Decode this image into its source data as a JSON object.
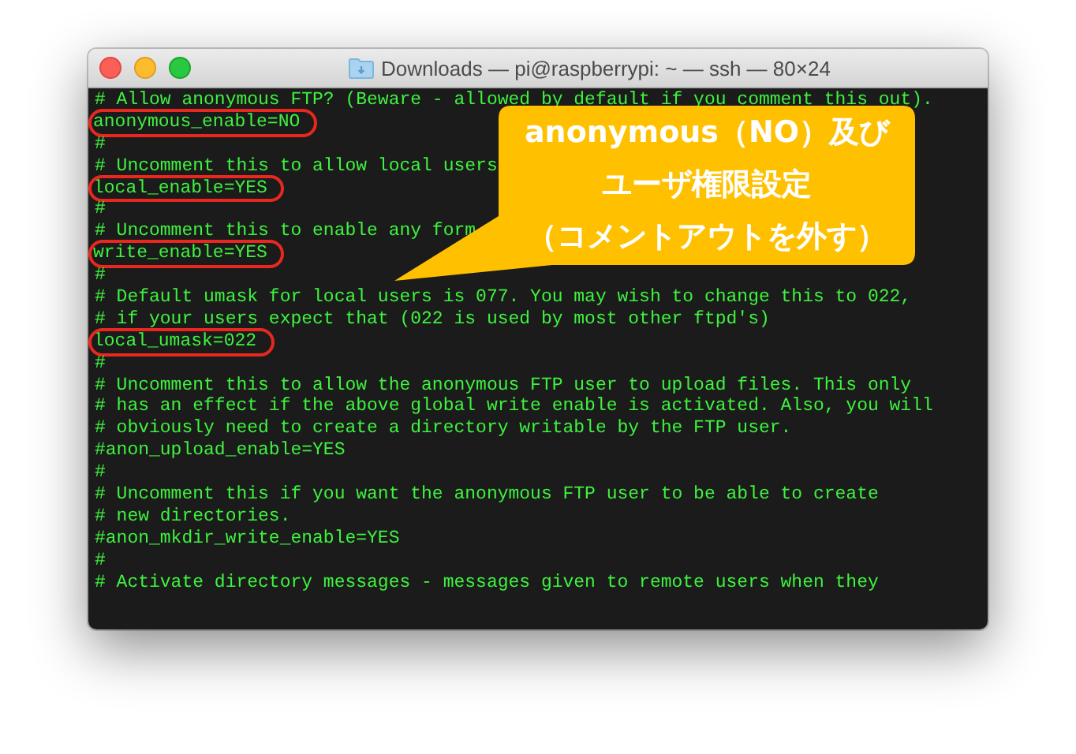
{
  "window": {
    "title": "Downloads — pi@raspberrypi: ~ — ssh — 80×24"
  },
  "terminal": {
    "lines": [
      {
        "text": "# Allow anonymous FTP? (Beware - allowed by default if you comment this out).",
        "highlighted": false
      },
      {
        "text": "anonymous_enable=NO",
        "highlighted": true
      },
      {
        "text": "#",
        "highlighted": false
      },
      {
        "text": "# Uncomment this to allow local users",
        "highlighted": false
      },
      {
        "text": "local_enable=YES",
        "highlighted": true
      },
      {
        "text": "#",
        "highlighted": false
      },
      {
        "text": "# Uncomment this to enable any form",
        "highlighted": false
      },
      {
        "text": "write_enable=YES",
        "highlighted": true
      },
      {
        "text": "#",
        "highlighted": false
      },
      {
        "text": "# Default umask for local users is 077. You may wish to change this to 022,",
        "highlighted": false
      },
      {
        "text": "# if your users expect that (022 is used by most other ftpd's)",
        "highlighted": false
      },
      {
        "text": "local_umask=022",
        "highlighted": true
      },
      {
        "text": "#",
        "highlighted": false
      },
      {
        "text": "# Uncomment this to allow the anonymous FTP user to upload files. This only",
        "highlighted": false
      },
      {
        "text": "# has an effect if the above global write enable is activated. Also, you will",
        "highlighted": false
      },
      {
        "text": "# obviously need to create a directory writable by the FTP user.",
        "highlighted": false
      },
      {
        "text": "#anon_upload_enable=YES",
        "highlighted": false
      },
      {
        "text": "#",
        "highlighted": false
      },
      {
        "text": "# Uncomment this if you want the anonymous FTP user to be able to create",
        "highlighted": false
      },
      {
        "text": "# new directories.",
        "highlighted": false
      },
      {
        "text": "#anon_mkdir_write_enable=YES",
        "highlighted": false
      },
      {
        "text": "#",
        "highlighted": false
      },
      {
        "text": "# Activate directory messages - messages given to remote users when they",
        "highlighted": false
      }
    ]
  },
  "callout": {
    "lines": [
      "anonymous（NO）及び",
      "ユーザ権限設定",
      "（コメントアウトを外す）"
    ]
  }
}
